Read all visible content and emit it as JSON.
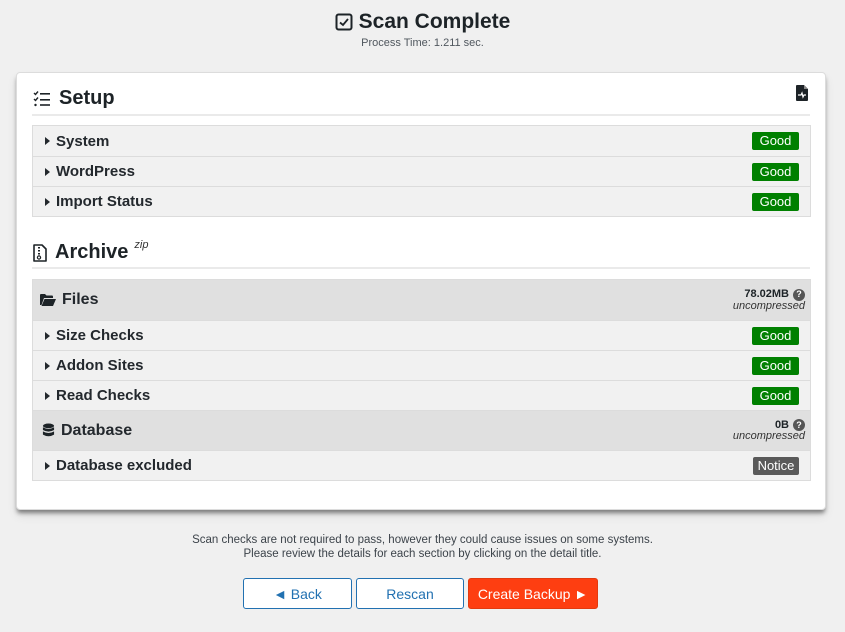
{
  "header": {
    "title": "Scan Complete",
    "process_time": "Process Time: 1.211 sec."
  },
  "setup": {
    "title": "Setup",
    "items": [
      {
        "label": "System",
        "status": "Good"
      },
      {
        "label": "WordPress",
        "status": "Good"
      },
      {
        "label": "Import Status",
        "status": "Good"
      }
    ]
  },
  "archive": {
    "title": "Archive",
    "format": "zip",
    "files": {
      "label": "Files",
      "size": "78.02MB",
      "size_note": "uncompressed",
      "items": [
        {
          "label": "Size Checks",
          "status": "Good"
        },
        {
          "label": "Addon Sites",
          "status": "Good"
        },
        {
          "label": "Read Checks",
          "status": "Good"
        }
      ]
    },
    "database": {
      "label": "Database",
      "size": "0B",
      "size_note": "uncompressed",
      "items": [
        {
          "label": "Database excluded",
          "status": "Notice"
        }
      ]
    }
  },
  "footer": {
    "note_line1": "Scan checks are not required to pass, however they could cause issues on some systems.",
    "note_line2": "Please review the details for each section by clicking on the detail title."
  },
  "buttons": {
    "back": "◄ Back",
    "rescan": "Rescan",
    "create": "Create Backup ►"
  },
  "help_glyph": "?",
  "colors": {
    "good": "#008000",
    "notice": "#5a5a5a",
    "primary": "#fe3e11",
    "link": "#2271b1"
  }
}
